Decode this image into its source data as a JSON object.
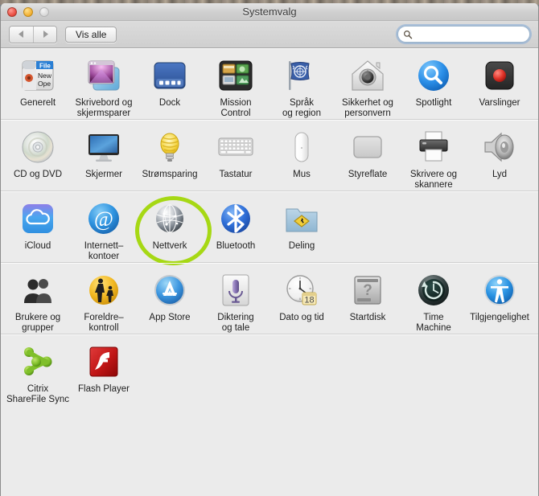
{
  "window": {
    "title": "Systemvalg",
    "traffic_lights": [
      "close-button",
      "minimize-button",
      "zoom-button"
    ]
  },
  "toolbar": {
    "back_label": "◀",
    "forward_label": "▶",
    "show_all_label": "Vis alle",
    "search_value": "",
    "search_placeholder": ""
  },
  "highlight": {
    "target": "Nettverk",
    "color": "#a6d814"
  },
  "rows": [
    {
      "id": "personal",
      "items": [
        {
          "name": "generelt",
          "label": "Generelt",
          "icon": "general-icon"
        },
        {
          "name": "skrivebord",
          "label": "Skrivebord og\nskjermsparer",
          "icon": "desktop-screensaver-icon"
        },
        {
          "name": "dock",
          "label": "Dock",
          "icon": "dock-icon"
        },
        {
          "name": "mission-control",
          "label": "Mission\nControl",
          "icon": "mission-control-icon"
        },
        {
          "name": "sprak-region",
          "label": "Språk\nog region",
          "icon": "language-region-icon"
        },
        {
          "name": "sikkerhet",
          "label": "Sikkerhet og\npersonvern",
          "icon": "security-privacy-icon"
        },
        {
          "name": "spotlight",
          "label": "Spotlight",
          "icon": "spotlight-icon"
        },
        {
          "name": "varslinger",
          "label": "Varslinger",
          "icon": "notifications-icon"
        }
      ]
    },
    {
      "id": "hardware",
      "items": [
        {
          "name": "cd-dvd",
          "label": "CD og DVD",
          "icon": "cd-dvd-icon"
        },
        {
          "name": "skjermer",
          "label": "Skjermer",
          "icon": "displays-icon"
        },
        {
          "name": "stromsparing",
          "label": "Strømsparing",
          "icon": "energy-saver-icon"
        },
        {
          "name": "tastatur",
          "label": "Tastatur",
          "icon": "keyboard-icon"
        },
        {
          "name": "mus",
          "label": "Mus",
          "icon": "mouse-icon"
        },
        {
          "name": "styreflate",
          "label": "Styreflate",
          "icon": "trackpad-icon"
        },
        {
          "name": "skrivere",
          "label": "Skrivere og\nskannere",
          "icon": "printers-scanners-icon"
        },
        {
          "name": "lyd",
          "label": "Lyd",
          "icon": "sound-icon"
        }
      ]
    },
    {
      "id": "internet",
      "items": [
        {
          "name": "icloud",
          "label": "iCloud",
          "icon": "icloud-icon"
        },
        {
          "name": "internett-kontoer",
          "label": "Internett–\nkontoer",
          "icon": "internet-accounts-icon"
        },
        {
          "name": "nettverk",
          "label": "Nettverk",
          "icon": "network-icon"
        },
        {
          "name": "bluetooth",
          "label": "Bluetooth",
          "icon": "bluetooth-icon"
        },
        {
          "name": "deling",
          "label": "Deling",
          "icon": "sharing-icon"
        }
      ]
    },
    {
      "id": "system",
      "items": [
        {
          "name": "brukere",
          "label": "Brukere og\ngrupper",
          "icon": "users-groups-icon"
        },
        {
          "name": "foreldrekontroll",
          "label": "Foreldre–\nkontroll",
          "icon": "parental-controls-icon"
        },
        {
          "name": "app-store",
          "label": "App Store",
          "icon": "app-store-icon"
        },
        {
          "name": "diktering",
          "label": "Diktering\nog tale",
          "icon": "dictation-speech-icon"
        },
        {
          "name": "dato-tid",
          "label": "Dato og tid",
          "icon": "date-time-icon"
        },
        {
          "name": "startdisk",
          "label": "Startdisk",
          "icon": "startup-disk-icon"
        },
        {
          "name": "time-machine",
          "label": "Time\nMachine",
          "icon": "time-machine-icon"
        },
        {
          "name": "tilgjengelighet",
          "label": "Tilgjengelighet",
          "icon": "accessibility-icon"
        }
      ]
    },
    {
      "id": "other",
      "items": [
        {
          "name": "citrix",
          "label": "Citrix\nShareFile Sync",
          "icon": "citrix-sharefile-icon"
        },
        {
          "name": "flash-player",
          "label": "Flash Player",
          "icon": "flash-player-icon"
        }
      ]
    }
  ]
}
